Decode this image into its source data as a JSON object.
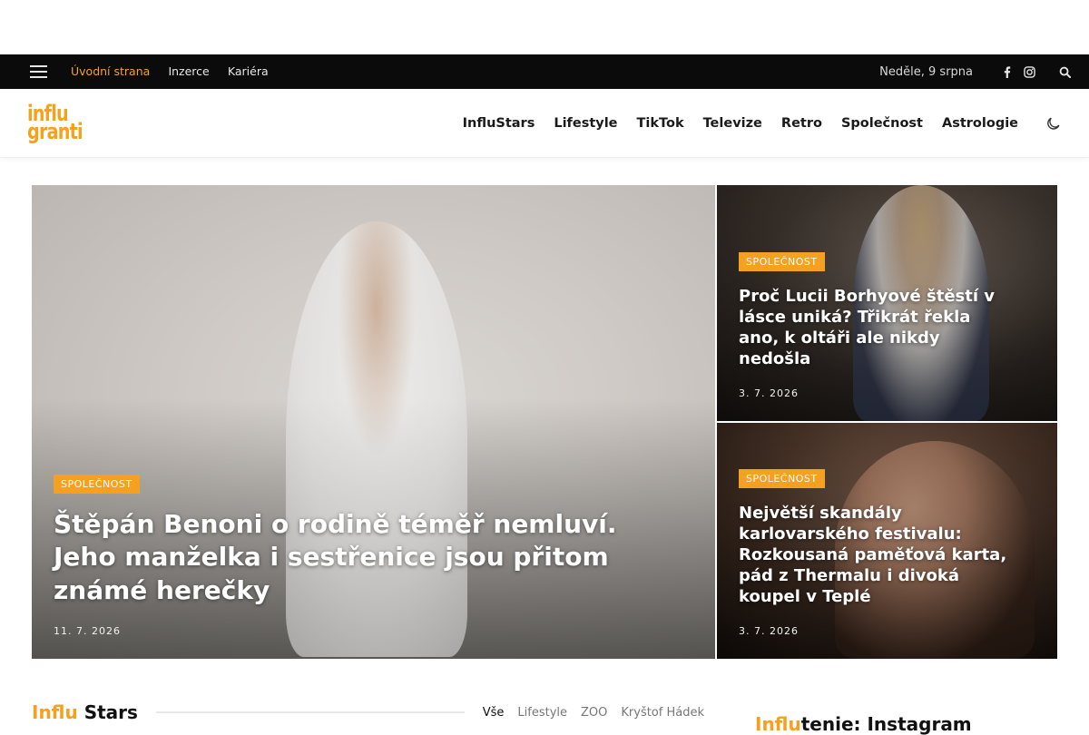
{
  "topbar": {
    "nav": [
      {
        "label": "Úvodní strana",
        "active": true
      },
      {
        "label": "Inzerce",
        "active": false
      },
      {
        "label": "Kariéra",
        "active": false
      }
    ],
    "date": "Neděle, 9 srpna",
    "social_icons": [
      "facebook-icon",
      "instagram-icon"
    ]
  },
  "header": {
    "logo_lines": [
      "influ",
      "granti"
    ],
    "nav": [
      "InfluStars",
      "Lifestyle",
      "TikTok",
      "Televize",
      "Retro",
      "Společnost",
      "Astrologie"
    ]
  },
  "hero": {
    "main": {
      "category": "SPOLEČNOST",
      "title": "Štěpán Benoni o rodině téměř nemluví. Jeho manželka i sestřenice jsou přitom známé herečky",
      "date": "11. 7. 2026"
    },
    "side_top": {
      "category": "SPOLEČNOST",
      "title": "Proč Lucii Borhyové štěstí v lásce uniká? Třikrát řekla ano, k oltáři ale nikdy nedošla",
      "date": "3. 7. 2026"
    },
    "side_bottom": {
      "category": "SPOLEČNOST",
      "title": "Největší skandály karlovarského festivalu: Rozkousaná paměťová karta, pád z Thermalu i divoká koupel v Teplé",
      "date": "3. 7. 2026"
    }
  },
  "section": {
    "title_highlight": "Influ",
    "title_rest": "Stars",
    "filters": [
      "Vše",
      "Lifestyle",
      "ZOO",
      "Kryštof Hádek"
    ]
  },
  "sidebar": {
    "title_highlight": "Influ",
    "title_rest": "tenie: Instagram"
  },
  "colors": {
    "accent": "#f6a020",
    "topbar_bg": "#0b0b0b"
  }
}
